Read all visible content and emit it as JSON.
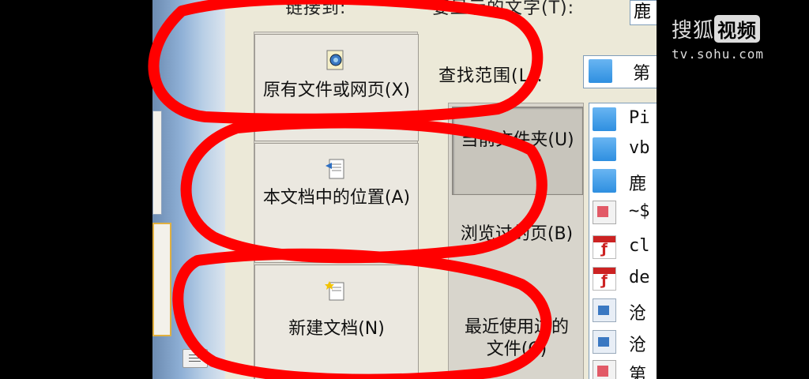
{
  "dialog": {
    "link_to_label": "链接到:",
    "display_text_label": "要显示的文字(T):",
    "display_text_value": "鹿",
    "link_to_options": [
      {
        "label": "原有文件或网页(X)",
        "icon": "globe-file-icon"
      },
      {
        "label": "本文档中的位置(A)",
        "icon": "document-place-icon"
      },
      {
        "label": "新建文档(N)",
        "icon": "new-document-icon"
      }
    ],
    "search_in_label": "查找范围(L):",
    "search_in_value": "第",
    "nav_buttons": [
      {
        "label": "当前文件夹(U)",
        "active": true
      },
      {
        "label": "浏览过的页(B)",
        "active": false
      },
      {
        "label": "最近使用过的文件(C)",
        "active": false
      }
    ],
    "files": [
      {
        "name": "Pi",
        "icon": "folder-icon"
      },
      {
        "name": "vb",
        "icon": "folder-icon"
      },
      {
        "name": "鹿",
        "icon": "folder-icon"
      },
      {
        "name": "~$",
        "icon": "document-icon"
      },
      {
        "name": "cl",
        "icon": "flash-file-icon"
      },
      {
        "name": "de",
        "icon": "flash-file-icon"
      },
      {
        "name": "沧",
        "icon": "app-file-icon"
      },
      {
        "name": "沧",
        "icon": "app-file-icon"
      },
      {
        "name": "第",
        "icon": "document-icon"
      }
    ]
  },
  "watermark": {
    "brand": "搜狐",
    "video": "视频",
    "url": "tv.sohu.com"
  },
  "colors": {
    "annotation": "#ff0000",
    "frame_bg": "#000000",
    "dialog_bg": "#ece9d8",
    "accent": "#2e8fe0"
  }
}
